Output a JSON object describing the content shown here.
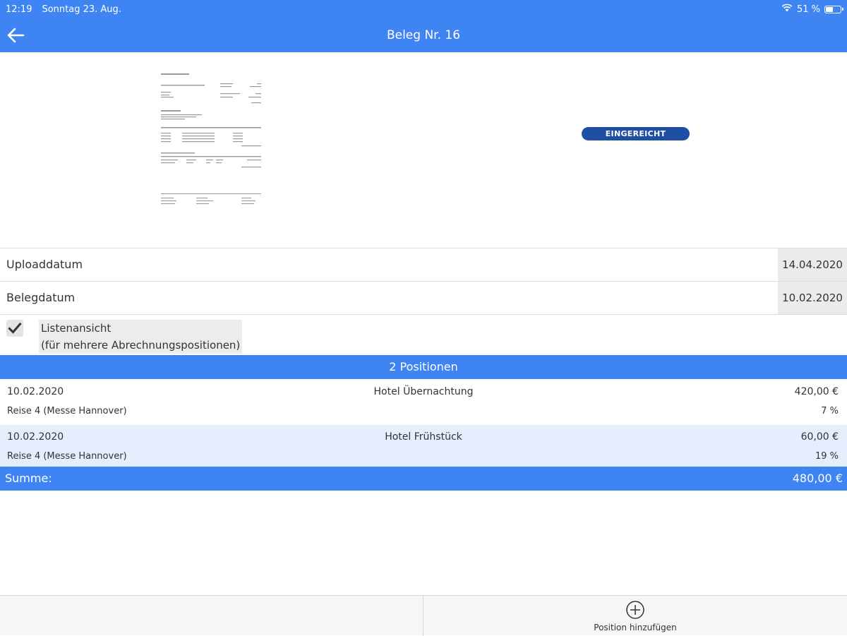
{
  "status_bar": {
    "time": "12:19",
    "date": "Sonntag 23. Aug.",
    "battery": "51 %",
    "battery_level": 0.51
  },
  "header": {
    "title": "Beleg Nr. 16",
    "back_icon": "arrow-left-icon"
  },
  "receipt": {
    "status": "EINGEREICHT"
  },
  "fields": {
    "upload": {
      "label": "Uploaddatum",
      "value": "14.04.2020"
    },
    "beleg": {
      "label": "Belegdatum",
      "value": "10.02.2020"
    }
  },
  "list_view": {
    "checked": true,
    "label_line1": "Listenansicht",
    "label_line2": "(für mehrere Abrechnungspositionen)"
  },
  "positions": {
    "header": "2 Positionen",
    "items": [
      {
        "date": "10.02.2020",
        "description": "Hotel Übernachtung",
        "amount": "420,00 €",
        "trip": "Reise 4 (Messe Hannover)",
        "tax": "7 %"
      },
      {
        "date": "10.02.2020",
        "description": "Hotel Frühstück",
        "amount": "60,00 €",
        "trip": "Reise 4 (Messe Hannover)",
        "tax": "19 %"
      }
    ]
  },
  "sum": {
    "label": "Summe:",
    "value": "480,00 €"
  },
  "toolbar": {
    "add_label": "Position hinzufügen",
    "add_icon": "plus-circle-icon"
  },
  "colors": {
    "primary": "#3e84f2",
    "badge": "#1f4fa3",
    "row_highlight": "#e4eefc"
  }
}
